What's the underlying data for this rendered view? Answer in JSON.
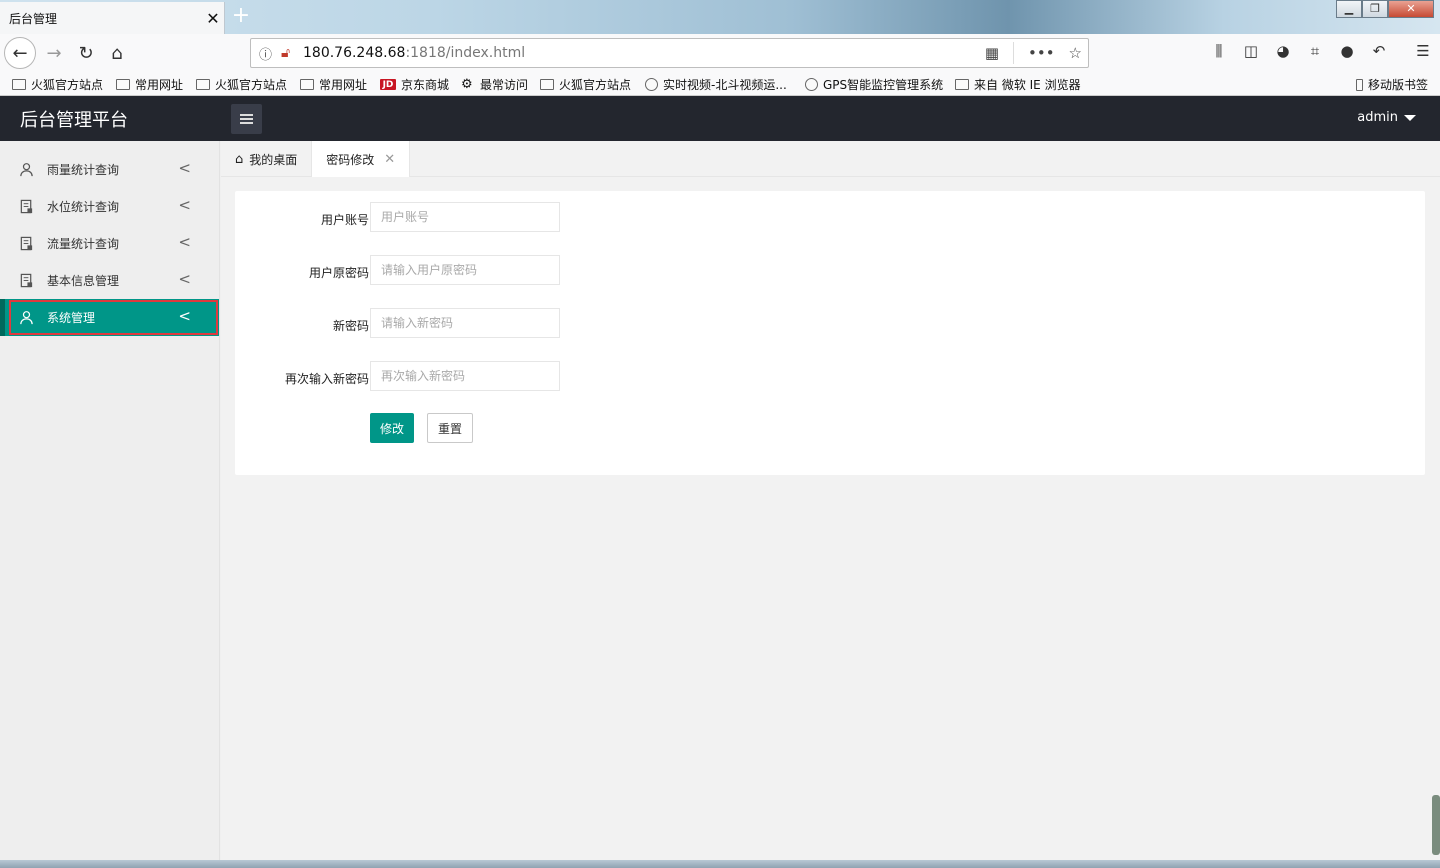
{
  "browser": {
    "tab_title": "后台管理",
    "tab_close": "✕",
    "new_tab": "+",
    "url_host": "180.76.248.68",
    "url_rest": ":1818/index.html",
    "bookmarks": [
      {
        "label": "火狐官方站点",
        "icon": "folder-icon"
      },
      {
        "label": "常用网址",
        "icon": "folder-icon"
      },
      {
        "label": "火狐官方站点",
        "icon": "folder-icon"
      },
      {
        "label": "常用网址",
        "icon": "folder-icon"
      },
      {
        "label": "京东商城",
        "icon": "jd-icon"
      },
      {
        "label": "最常访问",
        "icon": "gear-icon"
      },
      {
        "label": "火狐官方站点",
        "icon": "folder-icon"
      },
      {
        "label": "实时视频-北斗视频运...",
        "icon": "globe-icon"
      },
      {
        "label": "GPS智能监控管理系统",
        "icon": "globe-icon"
      },
      {
        "label": "来自 微软 IE 浏览器",
        "icon": "folder-icon"
      }
    ],
    "mobile_bookmarks": "移动版书签"
  },
  "app": {
    "logo": "后台管理平台",
    "user": "admin"
  },
  "sidebar": {
    "items": [
      {
        "label": "雨量统计查询",
        "icon": "user-icon"
      },
      {
        "label": "水位统计查询",
        "icon": "document-icon"
      },
      {
        "label": "流量统计查询",
        "icon": "document-icon"
      },
      {
        "label": "基本信息管理",
        "icon": "document-icon"
      },
      {
        "label": "系统管理",
        "icon": "users-icon",
        "active": true
      }
    ]
  },
  "tabs": [
    {
      "label": "我的桌面",
      "icon": "home-icon"
    },
    {
      "label": "密码修改",
      "closable": true,
      "active": true
    }
  ],
  "form": {
    "fields": [
      {
        "label": "用户账号",
        "placeholder": "用户账号"
      },
      {
        "label": "用户原密码",
        "placeholder": "请输入用户原密码"
      },
      {
        "label": "新密码",
        "placeholder": "请输入新密码"
      },
      {
        "label": "再次输入新密码",
        "placeholder": "再次输入新密码"
      }
    ],
    "submit_label": "修改",
    "reset_label": "重置"
  },
  "colors": {
    "accent": "#009688",
    "header": "#23262e",
    "highlight_border": "#e0393e"
  }
}
